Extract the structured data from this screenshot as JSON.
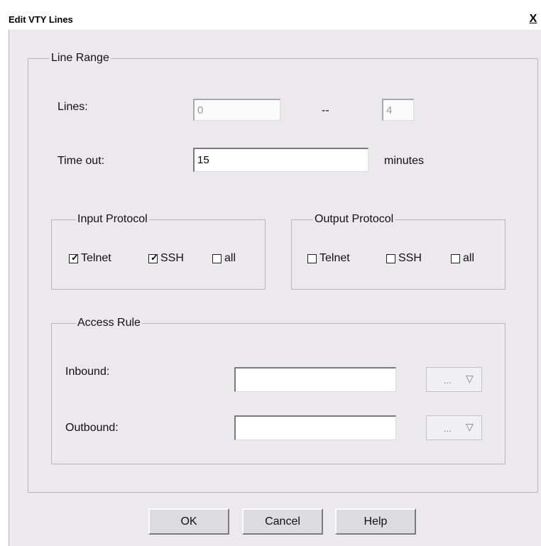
{
  "window": {
    "title": "Edit VTY Lines",
    "close_label": "X"
  },
  "line_range": {
    "legend": "Line Range",
    "lines_label": "Lines:",
    "line_start": "0",
    "separator": "--",
    "line_end": "4",
    "timeout_label": "Time out:",
    "timeout_value": "15",
    "timeout_unit": "minutes"
  },
  "input_protocol": {
    "legend": "Input Protocol",
    "options": [
      {
        "label": "Telnet",
        "checked": true
      },
      {
        "label": "SSH",
        "checked": true
      },
      {
        "label": "all",
        "checked": false
      }
    ]
  },
  "output_protocol": {
    "legend": "Output Protocol",
    "options": [
      {
        "label": "Telnet",
        "checked": false
      },
      {
        "label": "SSH",
        "checked": false
      },
      {
        "label": "all",
        "checked": false
      }
    ]
  },
  "access_rule": {
    "legend": "Access Rule",
    "inbound_label": "Inbound:",
    "inbound_value": "",
    "outbound_label": "Outbound:",
    "outbound_value": "",
    "picker_label": "..."
  },
  "buttons": {
    "ok": "OK",
    "cancel": "Cancel",
    "help": "Help"
  }
}
